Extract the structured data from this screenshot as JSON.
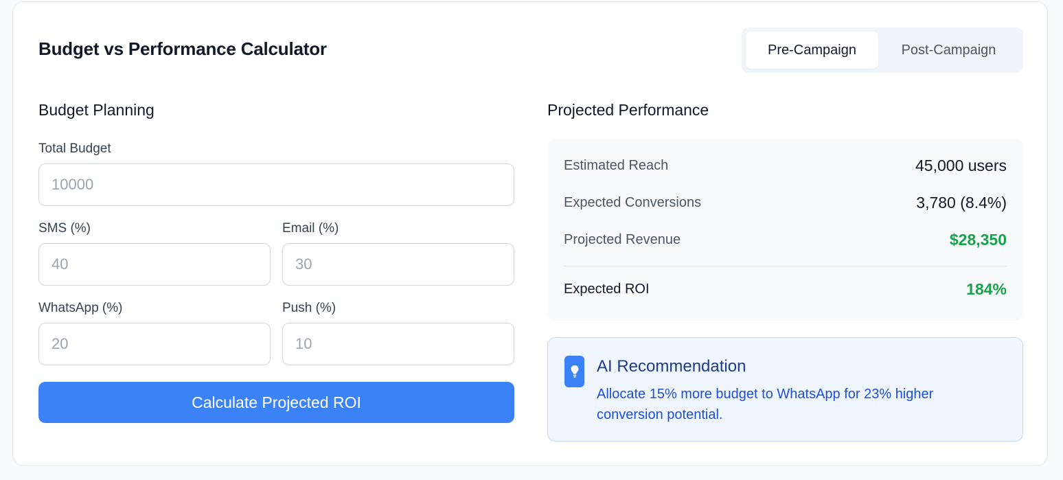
{
  "header": {
    "title": "Budget vs Performance Calculator",
    "tabs": [
      {
        "label": "Pre-Campaign",
        "active": true
      },
      {
        "label": "Post-Campaign",
        "active": false
      }
    ]
  },
  "budget": {
    "heading": "Budget Planning",
    "total_label": "Total Budget",
    "total_placeholder": "10000",
    "sms_label": "SMS (%)",
    "sms_placeholder": "40",
    "email_label": "Email (%)",
    "email_placeholder": "30",
    "whatsapp_label": "WhatsApp (%)",
    "whatsapp_placeholder": "20",
    "push_label": "Push (%)",
    "push_placeholder": "10",
    "button_label": "Calculate Projected ROI"
  },
  "performance": {
    "heading": "Projected Performance",
    "rows": [
      {
        "label": "Estimated Reach",
        "value": "45,000 users"
      },
      {
        "label": "Expected Conversions",
        "value": "3,780 (8.4%)"
      },
      {
        "label": "Projected Revenue",
        "value": "$28,350"
      }
    ],
    "roi_label": "Expected ROI",
    "roi_value": "184%"
  },
  "recommendation": {
    "icon": "lightbulb-icon",
    "title": "AI Recommendation",
    "text": "Allocate 15% more budget to WhatsApp for 23% higher conversion potential."
  },
  "colors": {
    "accent": "#3b82f6",
    "positive": "#16a34a",
    "recommendation_bg": "#eff6ff"
  }
}
